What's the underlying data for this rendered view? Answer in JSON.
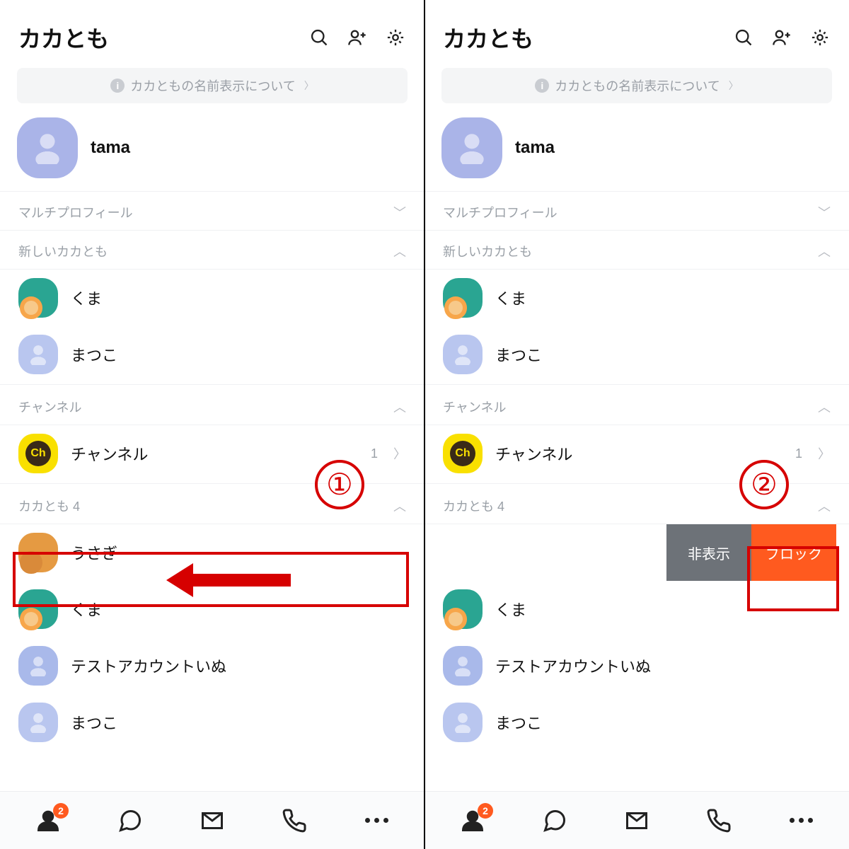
{
  "left": {
    "annot_number": "①",
    "header": {
      "title": "カカとも"
    },
    "banner": "カカともの名前表示について",
    "profile": {
      "name": "tama"
    },
    "sections": {
      "multi_profile": "マルチプロフィール",
      "new_friends": "新しいカカとも",
      "channel": "チャンネル",
      "friends_header": "カカとも 4"
    },
    "new_friends": [
      {
        "name": "くま"
      },
      {
        "name": "まつこ"
      }
    ],
    "channel_row": {
      "label": "チャンネル",
      "count": "1"
    },
    "friends": [
      {
        "name": "うさぎ"
      },
      {
        "name": "くま"
      },
      {
        "name": "テストアカウントいぬ"
      },
      {
        "name": "まつこ"
      }
    ],
    "tab_badge": "2"
  },
  "right": {
    "annot_number": "②",
    "header": {
      "title": "カカとも"
    },
    "banner": "カカともの名前表示について",
    "profile": {
      "name": "tama"
    },
    "sections": {
      "multi_profile": "マルチプロフィール",
      "new_friends": "新しいカカとも",
      "channel": "チャンネル",
      "friends_header": "カカとも 4"
    },
    "new_friends": [
      {
        "name": "くま"
      },
      {
        "name": "まつこ"
      }
    ],
    "channel_row": {
      "label": "チャンネル",
      "count": "1"
    },
    "swipe": {
      "hide": "非表示",
      "block": "ブロック"
    },
    "friends": [
      {
        "name": "くま"
      },
      {
        "name": "テストアカウントいぬ"
      },
      {
        "name": "まつこ"
      }
    ],
    "tab_badge": "2"
  }
}
